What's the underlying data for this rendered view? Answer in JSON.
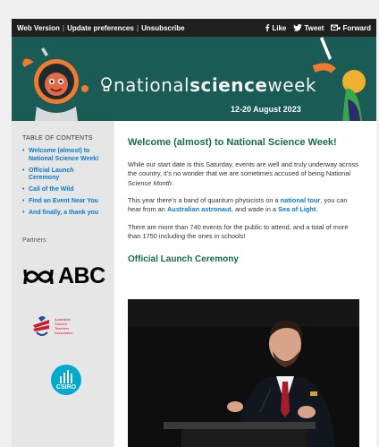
{
  "topbar": {
    "web_version": "Web Version",
    "update_prefs": "Update preferences",
    "unsubscribe": "Unsubscribe",
    "like": "Like",
    "tweet": "Tweet",
    "forward": "Forward"
  },
  "banner": {
    "word1": "national",
    "word2": "science",
    "word3": "week",
    "dates": "12-20 August 2023",
    "bg_color": "#1a5b55"
  },
  "sidebar": {
    "toc_title": "TABLE OF CONTENTS",
    "items": [
      "Welcome (almost) to National Science Week!",
      "Official Launch Ceremony",
      "Call of the Wild",
      "Find an Event Near You",
      "And finally, a thank you"
    ],
    "partners_label": "Partners",
    "abc_text": "ABC",
    "asta_lines": [
      "Australian",
      "Science",
      "Teachers",
      "Association"
    ],
    "csiro_text": "CSIRO"
  },
  "main": {
    "heading1": "Welcome (almost) to National Science Week!",
    "para1_a": "While our start date is this Saturday, events are well and truly underway across the country, it's no wonder that we are sometimes accused of being National Science ",
    "para1_em": "Month",
    "para1_b": ".",
    "para2_a": "This year there's a band of quantum physicists on a ",
    "para2_link1": "national tour",
    "para2_b": ", you can hear from an ",
    "para2_link2": "Australian astronaut",
    "para2_c": ", and wade in a ",
    "para2_link3": "Sea of Light",
    "para2_d": ".",
    "para3": "There are more than 740 events for the public to attend, and a total of more than 1750 including the ones in schools!",
    "heading2": "Official Launch Ceremony"
  }
}
